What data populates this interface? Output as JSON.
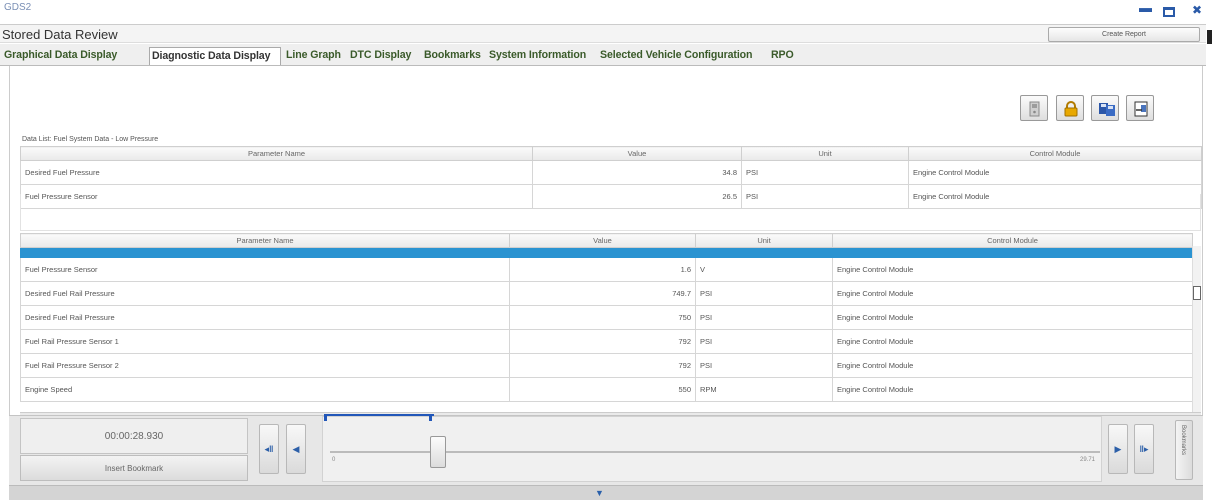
{
  "window": {
    "app_name": "GDS2",
    "minimize_glyph": "▬",
    "close_glyph": "✖"
  },
  "header": {
    "title": "Stored Data Review",
    "create_report_label": "Create Report"
  },
  "tabs": [
    {
      "label": "Graphical Data Display",
      "active": false
    },
    {
      "label": "Diagnostic Data Display",
      "active": true
    },
    {
      "label": "Line Graph",
      "active": false
    },
    {
      "label": "DTC Display",
      "active": false
    },
    {
      "label": "Bookmarks",
      "active": false
    },
    {
      "label": "System Information",
      "active": false
    },
    {
      "label": "Selected Vehicle Configuration",
      "active": false
    },
    {
      "label": "RPO",
      "active": false
    }
  ],
  "toolbar": {
    "icons": [
      "device-icon",
      "lock-icon",
      "save-icon",
      "export-icon"
    ]
  },
  "data_list_label": "Data List: Fuel System Data - Low Pressure",
  "table_top": {
    "headers": [
      "Parameter Name",
      "Value",
      "Unit",
      "Control Module"
    ],
    "rows": [
      [
        "Desired Fuel Pressure",
        "34.8",
        "PSI",
        "Engine Control Module"
      ],
      [
        "Fuel Pressure Sensor",
        "26.5",
        "PSI",
        "Engine Control Module"
      ]
    ]
  },
  "table_bottom": {
    "headers": [
      "Parameter Name",
      "Value",
      "Unit",
      "Control Module"
    ],
    "rows": [
      [
        "Fuel Pressure Sensor",
        "1.6",
        "V",
        "Engine Control Module"
      ],
      [
        "Desired Fuel Rail Pressure",
        "749.7",
        "PSI",
        "Engine Control Module"
      ],
      [
        "Desired Fuel Rail Pressure",
        "750",
        "PSI",
        "Engine Control Module"
      ],
      [
        "Fuel Rail Pressure Sensor 1",
        "792",
        "PSI",
        "Engine Control Module"
      ],
      [
        "Fuel Rail Pressure Sensor 2",
        "792",
        "PSI",
        "Engine Control Module"
      ],
      [
        "Engine Speed",
        "550",
        "RPM",
        "Engine Control Module"
      ]
    ]
  },
  "playback": {
    "time": "00:00:28.930",
    "insert_bookmark_label": "Insert Bookmark",
    "slider_start": "0",
    "slider_end": "29.71",
    "bookmarks_label": "Bookmarks",
    "nav_first": "◂‖",
    "nav_prev": "◀",
    "nav_next": "▶",
    "nav_last": "‖▸",
    "footer_glyph": "▼"
  },
  "colors": {
    "selection": "#2a93d1",
    "accent_blue": "#2257b9",
    "lock_yellow": "#e8a800"
  }
}
